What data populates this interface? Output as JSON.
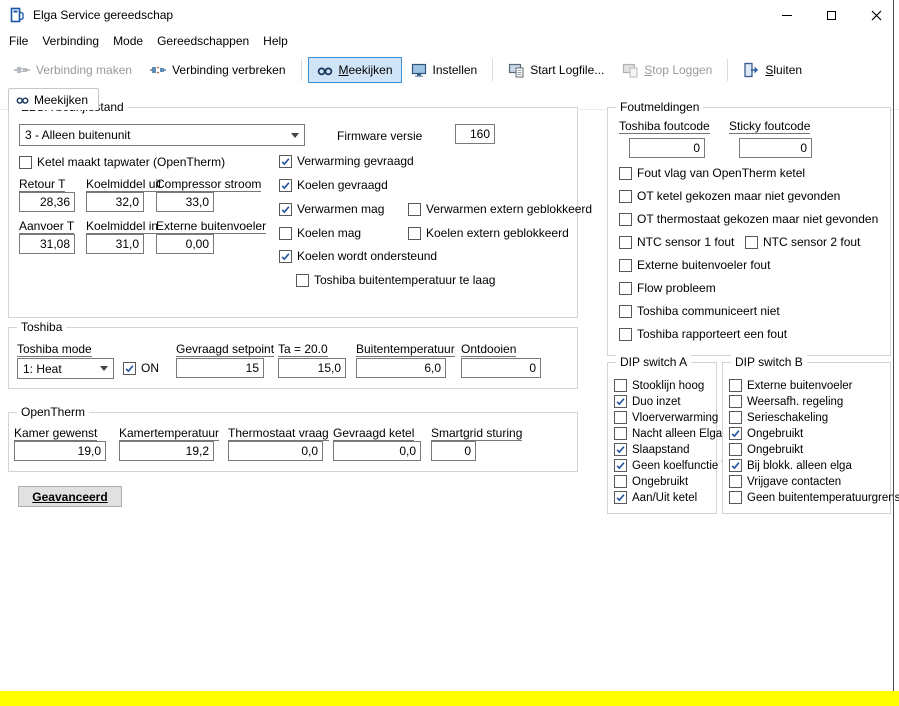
{
  "colors": {
    "toolbar_active_bg": "#cfe4f7",
    "toolbar_active_border": "#3d8fd1",
    "status_bar": "#ffff00",
    "checkmark": "#1e4fa0"
  },
  "icons": {
    "app-icon": "blue-device",
    "connect-icon": "plug",
    "disconnect-icon": "plug-broken",
    "meekijken-icon": "glasses",
    "instellen-icon": "monitor",
    "start-logfile-icon": "monitor-document",
    "stop-loggen-icon": "monitor-gray",
    "sluiten-icon": "exit-door",
    "minimize-icon": "dash",
    "maximize-icon": "square",
    "close-icon": "x"
  },
  "window": {
    "title": "Elga Service gereedschap"
  },
  "menu": {
    "items": [
      {
        "label": "File"
      },
      {
        "label": "Verbinding"
      },
      {
        "label": "Mode"
      },
      {
        "label": "Gereedschappen"
      },
      {
        "label": "Help"
      }
    ]
  },
  "toolbar": {
    "verbinding_maken": "Verbinding maken",
    "verbinding_verbreken": "Verbinding verbreken",
    "meekijken": "Meekijken",
    "instellen": "Instellen",
    "start_logfile": "Start Logfile...",
    "stop_loggen": "Stop Loggen",
    "sluiten": "Sluiten"
  },
  "tab": {
    "label": "Meekijken"
  },
  "elga": {
    "legend": "ELGA bedrijfsstand",
    "mode_value": "3 - Alleen buitenunit",
    "firmware_label": "Firmware versie",
    "firmware_value": "160",
    "tapwater": {
      "label": "Ketel maakt tapwater (OpenTherm)",
      "checked": false
    },
    "sensors": [
      {
        "label": "Retour T",
        "value": "28,36"
      },
      {
        "label": "Koelmiddel uit",
        "value": "32,0"
      },
      {
        "label": "Compressor stroom",
        "value": "33,0"
      },
      {
        "label": "Aanvoer T",
        "value": "31,08"
      },
      {
        "label": "Koelmiddel in",
        "value": "31,0"
      },
      {
        "label": "Externe buitenvoeler",
        "value": "0,00"
      }
    ],
    "flags": [
      {
        "label": "Verwarming gevraagd",
        "checked": true
      },
      {
        "label": "Koelen gevraagd",
        "checked": true
      },
      {
        "label": "Verwarmen mag",
        "checked": true
      },
      {
        "label": "Verwarmen extern geblokkeerd",
        "checked": false
      },
      {
        "label": "Koelen mag",
        "checked": false
      },
      {
        "label": "Koelen extern geblokkeerd",
        "checked": false
      },
      {
        "label": "Koelen wordt ondersteund",
        "checked": true
      },
      {
        "label": "Toshiba buitentemperatuur te laag",
        "checked": false
      }
    ]
  },
  "toshiba": {
    "legend": "Toshiba",
    "mode_label": "Toshiba mode",
    "mode_value": "1: Heat",
    "on": {
      "label": "ON",
      "checked": true
    },
    "fields": [
      {
        "label": "Gevraagd setpoint",
        "value": "15"
      },
      {
        "label": "Ta = 20.0",
        "value": "15,0"
      },
      {
        "label": "Buitentemperatuur",
        "value": "6,0"
      },
      {
        "label": "Ontdooien",
        "value": "0"
      }
    ]
  },
  "opentherm": {
    "legend": "OpenTherm",
    "fields": [
      {
        "label": "Kamer gewenst",
        "value": "19,0"
      },
      {
        "label": "Kamertemperatuur",
        "value": "19,2"
      },
      {
        "label": "Thermostaat vraag",
        "value": "0,0"
      },
      {
        "label": "Gevraagd ketel",
        "value": "0,0"
      },
      {
        "label": "Smartgrid sturing",
        "value": "0"
      }
    ]
  },
  "geavanceerd_label": "Geavanceerd",
  "fout": {
    "legend": "Foutmeldingen",
    "toshiba_foutcode_label": "Toshiba foutcode",
    "toshiba_foutcode_value": "0",
    "sticky_foutcode_label": "Sticky foutcode",
    "sticky_foutcode_value": "0",
    "flags": [
      {
        "label": "Fout vlag van OpenTherm ketel",
        "checked": false
      },
      {
        "label": "OT ketel gekozen maar niet gevonden",
        "checked": false
      },
      {
        "label": "OT thermostaat gekozen maar niet gevonden",
        "checked": false
      },
      {
        "label": "NTC sensor 1 fout",
        "checked": false
      },
      {
        "label": "NTC sensor 2 fout",
        "checked": false
      },
      {
        "label": "Externe buitenvoeler fout",
        "checked": false
      },
      {
        "label": "Flow probleem",
        "checked": false
      },
      {
        "label": "Toshiba communiceert niet",
        "checked": false
      },
      {
        "label": "Toshiba rapporteert een fout",
        "checked": false
      }
    ]
  },
  "dip_a": {
    "legend": "DIP switch A",
    "items": [
      {
        "label": "Stooklijn hoog",
        "checked": false
      },
      {
        "label": "Duo inzet",
        "checked": true
      },
      {
        "label": "Vloerverwarming",
        "checked": false
      },
      {
        "label": "Nacht alleen Elga",
        "checked": false
      },
      {
        "label": "Slaapstand",
        "checked": true
      },
      {
        "label": "Geen koelfunctie Th.",
        "checked": true
      },
      {
        "label": "Ongebruikt",
        "checked": false
      },
      {
        "label": "Aan/Uit ketel",
        "checked": true
      }
    ]
  },
  "dip_b": {
    "legend": "DIP switch B",
    "items": [
      {
        "label": "Externe buitenvoeler",
        "checked": false
      },
      {
        "label": "Weersafh. regeling",
        "checked": false
      },
      {
        "label": "Serieschakeling",
        "checked": false
      },
      {
        "label": "Ongebruikt",
        "checked": true
      },
      {
        "label": "Ongebruikt",
        "checked": false
      },
      {
        "label": "Bij blokk. alleen elga",
        "checked": true
      },
      {
        "label": "Vrijgave contacten",
        "checked": false
      },
      {
        "label": "Geen buitentemperatuurgrens",
        "checked": false
      }
    ]
  }
}
